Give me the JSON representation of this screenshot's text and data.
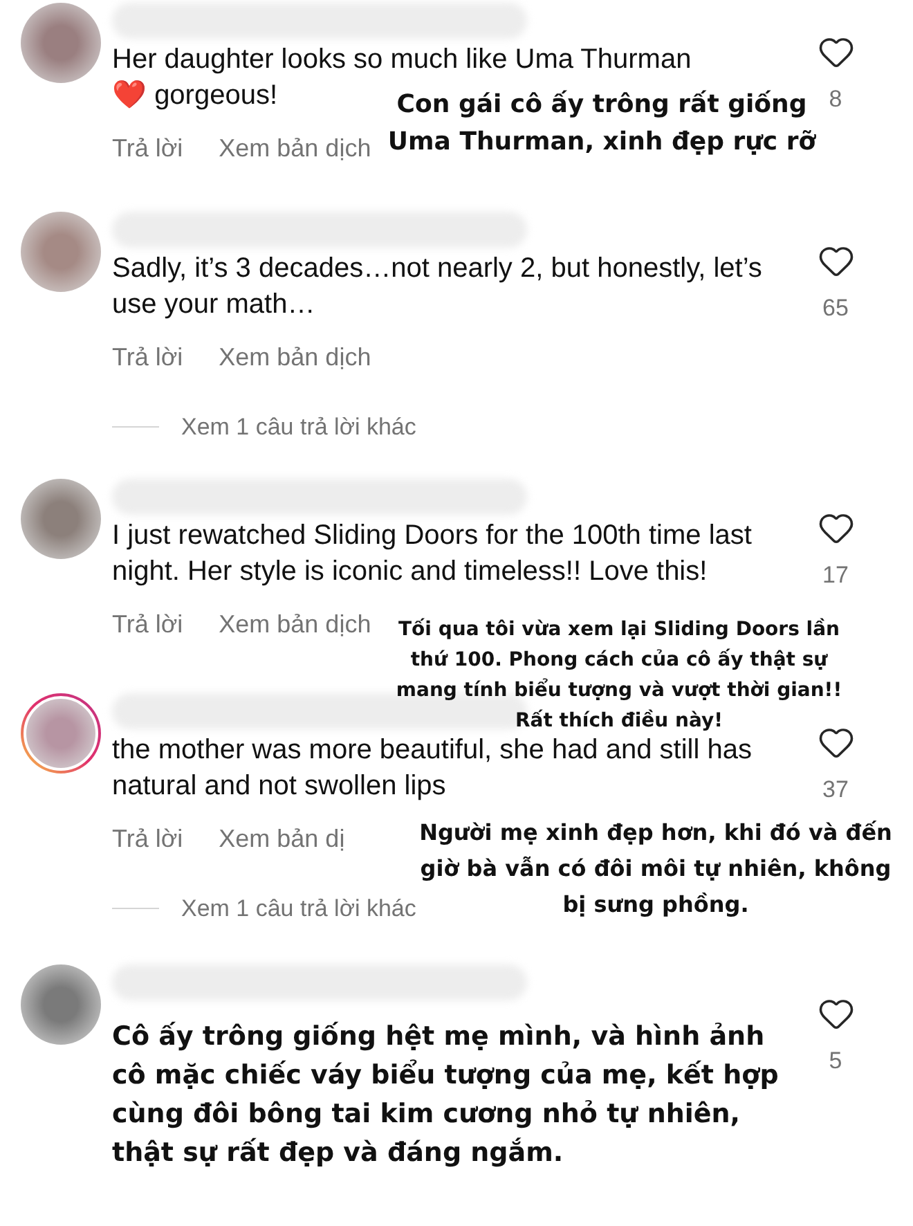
{
  "comments": [
    {
      "color": "#9a7f80",
      "story_ring": false,
      "text": "Her daughter looks so much like Uma Thurman",
      "emoji": "❤️",
      "text_after_emoji": "gorgeous!",
      "likes": "8",
      "reply": "Trả lời",
      "translate": "Xem bản dịch",
      "translation": "Con gái cô ấy trông rất giống Uma Thurman, xinh đẹp rực rỡ"
    },
    {
      "color": "#a58a85",
      "story_ring": false,
      "text": "Sadly, it’s 3 decades…not nearly 2, but honestly, let’s use your math…",
      "likes": "65",
      "reply": "Trả lời",
      "translate": "Xem bản dịch",
      "more_replies": "Xem 1 câu trả lời khác"
    },
    {
      "color": "#8c807b",
      "story_ring": false,
      "text": "I just rewatched Sliding Doors for the 100th time last night. Her style is iconic and timeless!! Love this!",
      "likes": "17",
      "reply": "Trả lời",
      "translate": "Xem bản dịch",
      "translation": "Tối qua tôi vừa xem lại Sliding Doors lần thứ 100. Phong cách của cô ấy thật sự mang tính biểu tượng và vượt thời gian!! Rất thích điều này!"
    },
    {
      "color": "#b795a3",
      "story_ring": true,
      "text": "the mother was more beautiful, she had and still has natural and not swollen lips",
      "likes": "37",
      "reply": "Trả lời",
      "translate": "Xem bản dị",
      "more_replies": "Xem 1 câu trả lời khác",
      "translation": "Người mẹ xinh đẹp hơn, khi đó và đến giờ bà vẫn có đôi môi tự nhiên, không bị sưng phồng."
    },
    {
      "color": "#7a7a7a",
      "story_ring": false,
      "likes": "5",
      "translation": "Cô ấy trông giống hệt mẹ mình, và hình ảnh cô mặc chiếc váy biểu tượng của mẹ, kết hợp cùng đôi bông tai kim cương nhỏ tự nhiên, thật sự rất đẹp và đáng ngắm."
    }
  ]
}
